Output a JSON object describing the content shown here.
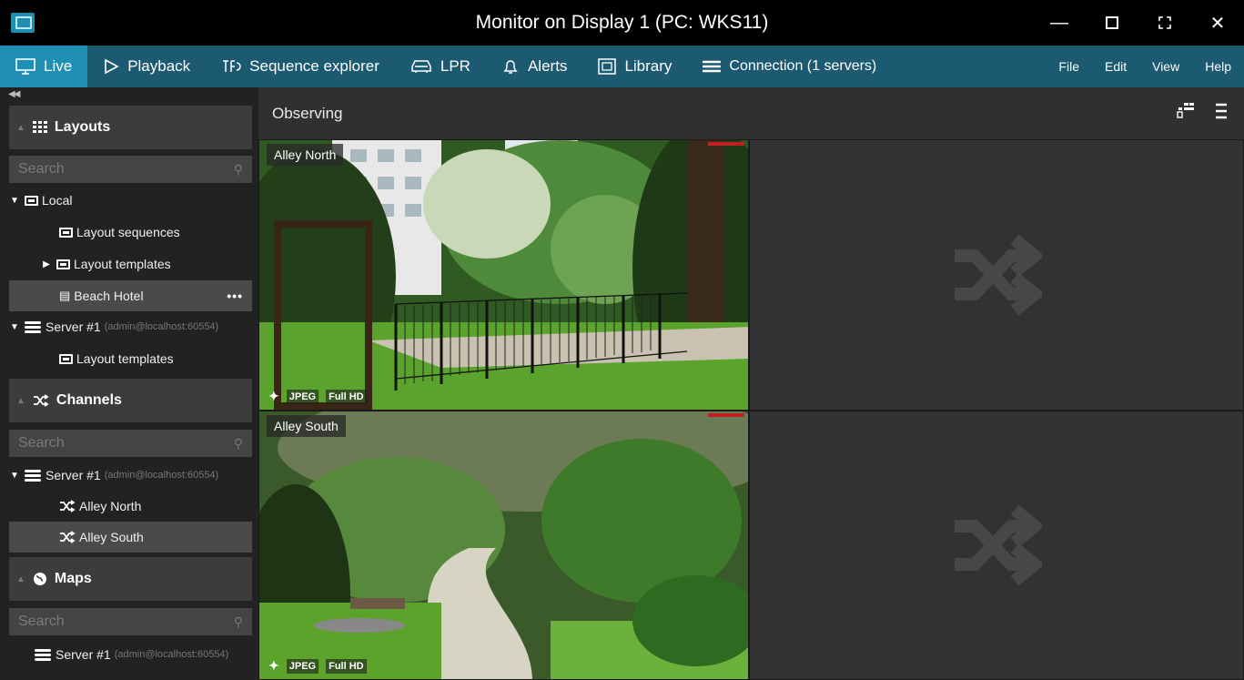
{
  "window": {
    "title": "Monitor  on Display 1 (PC: WKS11)",
    "controls": [
      "minimize",
      "maximize",
      "fullscreen",
      "close"
    ]
  },
  "menu": {
    "tabs": [
      {
        "label": "Live",
        "icon": "monitor-icon",
        "active": true
      },
      {
        "label": "Playback",
        "icon": "play-icon",
        "active": false
      },
      {
        "label": "Sequence explorer",
        "icon": "sequence-icon",
        "active": false
      },
      {
        "label": "LPR",
        "icon": "car-icon",
        "active": false
      },
      {
        "label": "Alerts",
        "icon": "bell-icon",
        "active": false
      },
      {
        "label": "Library",
        "icon": "library-icon",
        "active": false
      },
      {
        "label": "Connection (1 servers)",
        "icon": "server-stack-icon",
        "active": false
      }
    ],
    "right": [
      "File",
      "Edit",
      "View",
      "Help"
    ]
  },
  "sidebar": {
    "layouts": {
      "title": "Layouts",
      "search_placeholder": "Search",
      "tree": [
        {
          "label": "Local",
          "expanded": true
        },
        {
          "label": "Layout sequences"
        },
        {
          "label": "Layout templates",
          "expanded": false
        },
        {
          "label": "Beach Hotel",
          "selected": true,
          "more": "•••"
        },
        {
          "label": "Server #1",
          "detail": "(admin@localhost:60554)",
          "expanded": true
        },
        {
          "label": "Layout templates"
        }
      ]
    },
    "channels": {
      "title": "Channels",
      "search_placeholder": "Search",
      "tree": [
        {
          "label": "Server #1",
          "detail": "(admin@localhost:60554)",
          "expanded": true
        },
        {
          "label": "Alley North"
        },
        {
          "label": "Alley South",
          "selected": true
        }
      ]
    },
    "maps": {
      "title": "Maps",
      "search_placeholder": "Search",
      "tree": [
        {
          "label": "Server #1",
          "detail": "(admin@localhost:60554)"
        }
      ]
    }
  },
  "main": {
    "header": "Observing",
    "tiles": [
      {
        "label": "Alley North",
        "codec": "JPEG",
        "resolution": "Full HD"
      },
      {
        "label": "",
        "empty": true
      },
      {
        "label": "Alley South",
        "codec": "JPEG",
        "resolution": "Full HD"
      },
      {
        "label": "",
        "empty": true
      }
    ]
  },
  "colors": {
    "accent": "#1f8fb3",
    "menubar": "#1b5a70",
    "panel": "#222222"
  }
}
